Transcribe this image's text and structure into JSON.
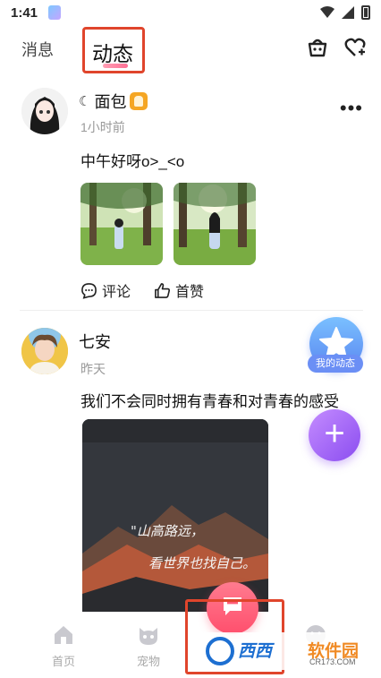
{
  "status_bar": {
    "time": "1:41"
  },
  "header": {
    "tab_messages": "消息",
    "tab_active": "动态"
  },
  "posts": [
    {
      "author": "面包",
      "time": "1小时前",
      "text": "中午好呀o>_<o",
      "actions": {
        "comment": "评论",
        "like": "首赞"
      }
    },
    {
      "author": "七安",
      "time": "昨天",
      "text": "我们不会同时拥有青春和对青春的感受",
      "image_caption_line1": "\"山高路远，",
      "image_caption_line2": "看世界也找自己。"
    }
  ],
  "floating": {
    "my_dynamic_label": "我的动态",
    "add_symbol": "+"
  },
  "bottom_nav": {
    "home": "首页",
    "pet": "宠物"
  },
  "watermark": {
    "brand_blue": "西西",
    "brand_orange": "软件园",
    "url": "CR173.COM"
  },
  "colors": {
    "accent_red": "#e0452c",
    "center_button": "#ff5a74",
    "add_button": "#9b5cf6",
    "my_dynamic_button": "#6b8ff5"
  },
  "icons": {
    "header": [
      "shop-basket-icon",
      "heart-plus-icon"
    ],
    "post_actions": [
      "comment-icon",
      "thumbs-up-icon"
    ],
    "bottom_nav": [
      "home-icon",
      "cat-face-icon",
      "message-icon",
      "smiley-icon"
    ]
  }
}
